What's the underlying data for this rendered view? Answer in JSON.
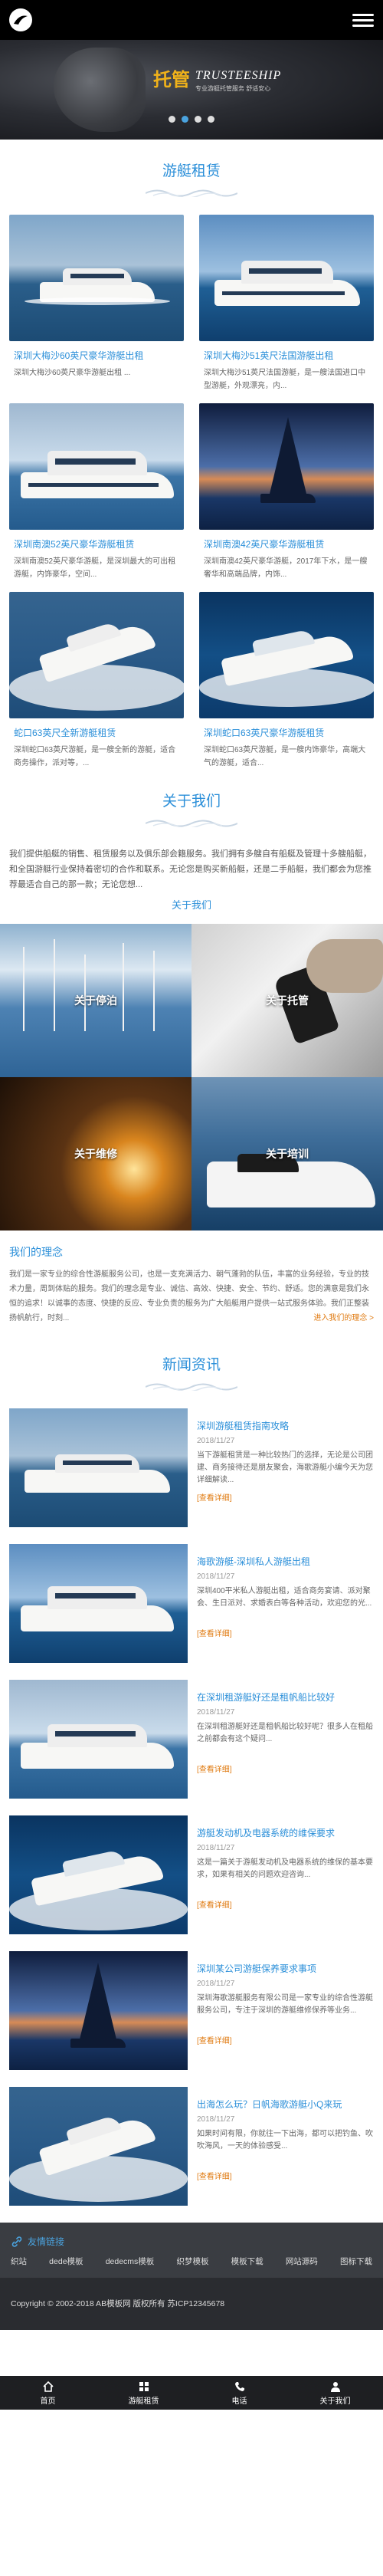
{
  "header": {
    "logo_icon": "logo-icon",
    "menu_icon": "menu-icon"
  },
  "banner": {
    "title_cn": "托管",
    "title_en": "TRUSTEESHIP",
    "subtitle": "专业游艇托管服务 舒适安心",
    "slides": 4,
    "active_slide": 2
  },
  "sections": {
    "rental": "游艇租赁",
    "about": "关于我们",
    "news": "新闻资讯"
  },
  "products": [
    {
      "name": "深圳大梅沙60英尺豪华游艇出租",
      "desc": "深圳大梅沙60英尺豪华游艇出租 ..."
    },
    {
      "name": "深圳大梅沙51英尺法国游艇出租",
      "desc": "深圳大梅沙51英尺法国游艇，是一艘法国进口中型游艇，外观漂亮，内..."
    },
    {
      "name": "深圳南澳52英尺豪华游艇租赁",
      "desc": "深圳南澳52英尺豪华游艇，是深圳最大的可出租游艇，内饰豪华，空间..."
    },
    {
      "name": "深圳南澳42英尺豪华游艇租赁",
      "desc": "深圳南澳42英尺豪华游艇，2017年下水，是一艘奢华和高端品牌，内饰..."
    },
    {
      "name": "蛇口63英尺全新游艇租赁",
      "desc": "深圳蛇口63英尺游艇，是一艘全新的游艇，适合商务操作，派对等，..."
    },
    {
      "name": "深圳蛇口63英尺豪华游艇租赁",
      "desc": "深圳蛇口63英尺游艇，是一艘内饰豪华，高端大气的游艇，适合..."
    }
  ],
  "about": {
    "text": "我们提供船艇的销售、租赁服务以及俱乐部会籍服务。我们拥有多艘自有船艇及管理十多艘船艇，和全国游艇行业保持着密切的合作和联系。无论您是购买新船艇，还是二手船艇，我们都会为您推荐最适合自己的那一款；无论您想...",
    "more": "关于我们",
    "tiles": [
      "关于停泊",
      "关于托管",
      "关于维修",
      "关于培训"
    ]
  },
  "idea": {
    "title": "我们的理念",
    "text": "我们是一家专业的综合性游艇服务公司，也是一支充满活力、朝气蓬勃的队伍，丰富的业务经验，专业的技术力量，周到体贴的服务。我们的理念是专业、诚信、高效、快捷、安全、节约、舒适。您的满意是我们永恒的追求！以诚事的态度、快捷的反应、专业负责的服务为广大船艇用户提供一站式服务体验。我们正整装扬帆航行，时刻...",
    "more": "进入我们的理念 >"
  },
  "news": [
    {
      "title": "深圳游艇租赁指南攻略",
      "date": "2018/11/27",
      "summary": "当下游艇租赁是一种比较热门的选择，无论是公司团建、商务接待还是朋友聚会，海歌游艇小编今天为您详细解读...",
      "more": "[查看详细]"
    },
    {
      "title": "海歌游艇-深圳私人游艇出租",
      "date": "2018/11/27",
      "summary": "深圳400平米私人游艇出租，适合商务宴请、派对聚会、生日派对、求婚表白等各种活动，欢迎您的光...",
      "more": "[查看详细]"
    },
    {
      "title": "在深圳租游艇好还是租帆船比较好",
      "date": "2018/11/27",
      "summary": "在深圳租游艇好还是租帆船比较好呢？很多人在租船之前都会有这个疑问...",
      "more": "[查看详细]"
    },
    {
      "title": "游艇发动机及电器系统的维保要求",
      "date": "2018/11/27",
      "summary": "这是一篇关于游艇发动机及电器系统的维保的基本要求，如果有相关的问题欢迎咨询...",
      "more": "[查看详细]"
    },
    {
      "title": "深圳某公司游艇保养要求事项",
      "date": "2018/11/27",
      "summary": "深圳海歌游艇服务有限公司是一家专业的综合性游艇服务公司，专注于深圳的游艇维修保养等业务...",
      "more": "[查看详细]"
    },
    {
      "title": "出海怎么玩？日帆海歌游艇小Q来玩",
      "date": "2018/11/27",
      "summary": "如果时间有限，你就往一下出海，都可以把钓鱼、吹吹海风，一天的体验感受...",
      "more": "[查看详细]"
    }
  ],
  "links": {
    "heading": "友情链接",
    "items": [
      "织站",
      "dede模板",
      "dedecms模板",
      "织梦模板",
      "模板下载",
      "网站源码",
      "图标下载"
    ]
  },
  "footer": {
    "copyright": "Copyright © 2002-2018 AB模板网 版权所有 苏ICP12345678"
  },
  "bottom_nav": [
    {
      "label": "首页",
      "icon": "home-icon"
    },
    {
      "label": "游艇租赁",
      "icon": "grid-icon"
    },
    {
      "label": "电话",
      "icon": "phone-icon"
    },
    {
      "label": "关于我们",
      "icon": "user-icon"
    }
  ]
}
